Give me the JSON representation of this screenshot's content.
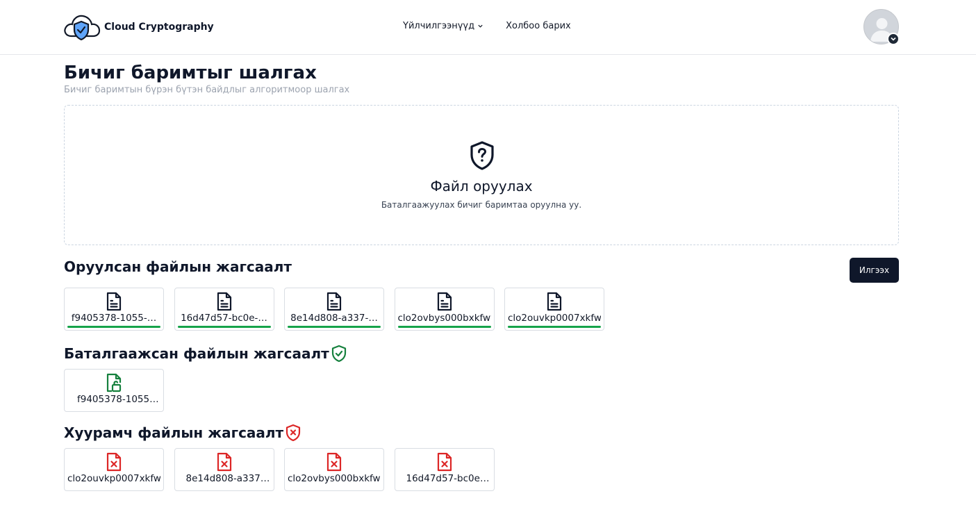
{
  "header": {
    "app_name": "Cloud Cryptography",
    "nav": {
      "services_label": "Үйлчилгээнүүд",
      "contact_label": "Холбоо барих"
    }
  },
  "page": {
    "title": "Бичиг баримтыг шалгах",
    "subtitle": "Бичиг баримтын бүрэн бүтэн байдлыг алгоритмоор шалгах"
  },
  "dropzone": {
    "title": "Файл оруулах",
    "subtitle": "Баталгаажуулах бичиг баримтаа оруулна уу."
  },
  "uploaded": {
    "title": "Оруулсан файлын жагсаалт",
    "send_label": "Илгээх",
    "files": [
      {
        "name": "f9405378-1055-…",
        "progress": 1.0
      },
      {
        "name": "16d47d57-bc0e-…",
        "progress": 1.0
      },
      {
        "name": "8e14d808-a337-…",
        "progress": 1.0
      },
      {
        "name": "clo2ovbys000bxkfwv",
        "progress": 1.0
      },
      {
        "name": "clo2ouvkp0007xkfw6",
        "progress": 1.0
      }
    ]
  },
  "verified": {
    "title": "Баталгаажсан файлын жагсаалт",
    "status_color": "#15803d",
    "files": [
      {
        "name": "f9405378-1055-…"
      }
    ]
  },
  "fake": {
    "title": "Хуурамч файлын жагсаалт",
    "status_color": "#dc2626",
    "files": [
      {
        "name": "clo2ouvkp0007xkfw6"
      },
      {
        "name": "8e14d808-a337-…"
      },
      {
        "name": "clo2ovbys000bxkfwv"
      },
      {
        "name": "16d47d57-bc0e-…"
      }
    ]
  }
}
